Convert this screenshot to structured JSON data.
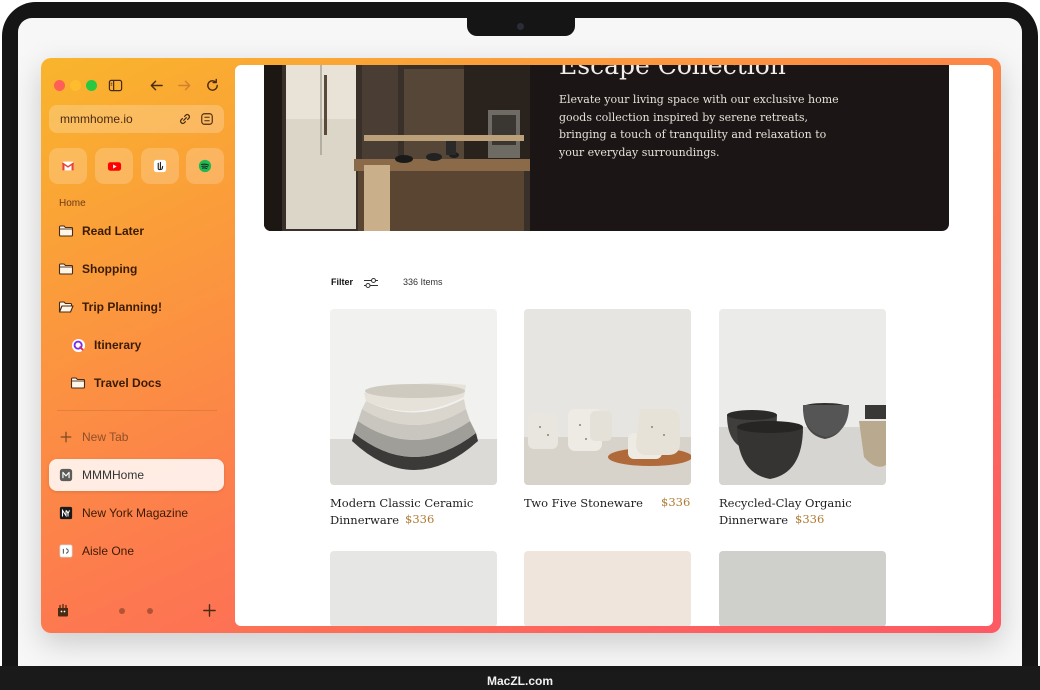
{
  "device": {
    "brand_label": "MacZL.com"
  },
  "sidebar": {
    "url": "mmmhome.io",
    "favorites": [
      {
        "name": "Gmail",
        "icon": "gmail-icon",
        "color": "#ea4335"
      },
      {
        "name": "YouTube",
        "icon": "youtube-icon",
        "color": "#ff0000"
      },
      {
        "name": "Peace app",
        "icon": "peace-hand-icon",
        "color": "#222222"
      },
      {
        "name": "Spotify",
        "icon": "spotify-icon",
        "color": "#1db954"
      }
    ],
    "section_label": "Home",
    "folders": [
      {
        "label": "Read Later"
      },
      {
        "label": "Shopping"
      },
      {
        "label": "Trip Planning!"
      }
    ],
    "subitems": [
      {
        "label": "Itinerary"
      },
      {
        "label": "Travel Docs"
      }
    ],
    "new_tab_label": "New Tab",
    "tabs": [
      {
        "label": "MMMHome",
        "active": true
      },
      {
        "label": "New York Magazine",
        "active": false
      },
      {
        "label": "Aisle One",
        "active": false
      }
    ]
  },
  "page": {
    "hero": {
      "title": "Escape Collection",
      "description": "Elevate your living space with our exclusive home goods collection inspired by serene retreats, bringing a touch of tranquility and relaxation to your everyday surroundings."
    },
    "toolbar": {
      "filter_label": "Filter",
      "item_count": "336 Items"
    },
    "products": [
      {
        "name": "Modern Classic Ceramic Dinnerware",
        "price": "$336"
      },
      {
        "name": "Two Five Stoneware",
        "price": "$336"
      },
      {
        "name": "Recycled-Clay Organic Dinnerware",
        "price": "$336"
      }
    ]
  },
  "colors": {
    "sidebar_gradient_start": "#f9b52c",
    "sidebar_gradient_end": "#fd5a63",
    "price": "#b07a33",
    "hero_bg": "#1b1516"
  }
}
